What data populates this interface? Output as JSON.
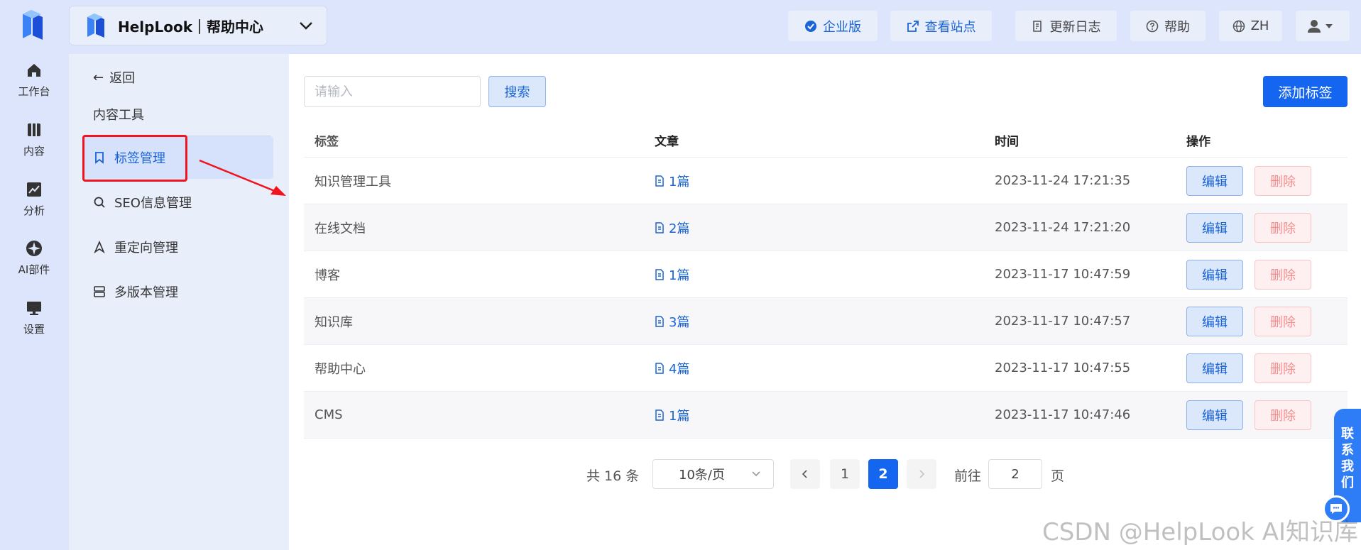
{
  "app": {
    "space_title": "HelpLook｜帮助中心"
  },
  "rail": {
    "items": [
      {
        "label": "工作台",
        "icon": "home-icon"
      },
      {
        "label": "内容",
        "icon": "book-icon"
      },
      {
        "label": "分析",
        "icon": "chart-icon"
      },
      {
        "label": "AI部件",
        "icon": "ai-widget-icon"
      },
      {
        "label": "设置",
        "icon": "monitor-icon"
      }
    ]
  },
  "topbar": {
    "enterprise": "企业版",
    "view_site": "查看站点",
    "changelog": "更新日志",
    "help": "帮助",
    "language": "ZH"
  },
  "subnav": {
    "back": "返回",
    "section_title": "内容工具",
    "items": [
      {
        "label": "标签管理",
        "icon": "bookmark-icon"
      },
      {
        "label": "SEO信息管理",
        "icon": "search-icon"
      },
      {
        "label": "重定向管理",
        "icon": "redirect-icon"
      },
      {
        "label": "多版本管理",
        "icon": "versions-icon"
      }
    ]
  },
  "toolbar": {
    "search_placeholder": "请输入",
    "search_label": "搜索",
    "add_label": "添加标签"
  },
  "table": {
    "columns": [
      "标签",
      "文章",
      "时间",
      "操作"
    ],
    "rows": [
      {
        "tag": "知识管理工具",
        "articles": "1篇",
        "time": "2023-11-24 17:21:35"
      },
      {
        "tag": "在线文档",
        "articles": "2篇",
        "time": "2023-11-24 17:21:20"
      },
      {
        "tag": "博客",
        "articles": "1篇",
        "time": "2023-11-17 10:47:59"
      },
      {
        "tag": "知识库",
        "articles": "3篇",
        "time": "2023-11-17 10:47:57"
      },
      {
        "tag": "帮助中心",
        "articles": "4篇",
        "time": "2023-11-17 10:47:55"
      },
      {
        "tag": "CMS",
        "articles": "1篇",
        "time": "2023-11-17 10:47:46"
      }
    ],
    "edit_label": "编辑",
    "delete_label": "删除"
  },
  "pagination": {
    "total": "共 16 条",
    "page_size": "10条/页",
    "pages": [
      "1",
      "2"
    ],
    "current": "2",
    "goto_label": "前往",
    "goto_value": "2",
    "page_unit": "页"
  },
  "contact": {
    "label_chars": [
      "联",
      "系",
      "我",
      "们"
    ]
  },
  "watermark": "CSDN @HelpLook AI知识库",
  "colors": {
    "primary": "#1465f0",
    "danger": "#f38c8c",
    "highlight": "#f0141e"
  }
}
